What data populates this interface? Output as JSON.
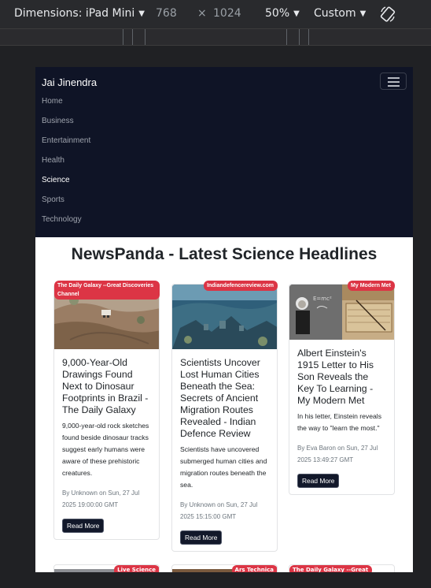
{
  "devtools": {
    "device_label": "Dimensions: iPad Mini",
    "width": "768",
    "times": "×",
    "height": "1024",
    "zoom": "50%",
    "throttle": "Custom"
  },
  "navbar": {
    "brand": "Jai Jinendra",
    "links": [
      "Home",
      "Business",
      "Entertainment",
      "Health",
      "Science",
      "Sports",
      "Technology"
    ],
    "active": "Science"
  },
  "page": {
    "title": "NewsPanda - Latest Science Headlines"
  },
  "cards": [
    {
      "source": "The Daily Galaxy --Great Discoveries Channel",
      "title": "9,000-Year-Old Drawings Found Next to Dinosaur Footprints in Brazil - The Daily Galaxy",
      "description": "9,000-year-old rock sketches found beside dinosaur tracks suggest early humans were aware of these prehistoric creatures.",
      "meta": "By Unknown on Sun, 27 Jul 2025 19:00:00 GMT",
      "button": "Read More"
    },
    {
      "source": "Indiandefencereview.com",
      "title": "Scientists Uncover Lost Human Cities Beneath the Sea: Secrets of Ancient Migration Routes Revealed - Indian Defence Review",
      "description": "Scientists have uncovered submerged human cities and migration routes beneath the sea.",
      "meta": "By Unknown on Sun, 27 Jul 2025 15:15:00 GMT",
      "button": "Read More"
    },
    {
      "source": "My Modern Met",
      "title": "Albert Einstein's 1915 Letter to His Son Reveals the Key To Learning - My Modern Met",
      "description": "In his letter, Einstein reveals the way to \"learn the most.\"",
      "meta": "By Eva Baron on Sun, 27 Jul 2025 13:49:27 GMT",
      "button": "Read More"
    }
  ],
  "peek_cards": [
    {
      "source": "Live Science"
    },
    {
      "source": "Ars Technica"
    },
    {
      "source": "The Daily Galaxy --Great"
    }
  ],
  "colors": {
    "navbar_bg": "#0f1426",
    "badge": "#dc3545",
    "button": "#12182a"
  }
}
